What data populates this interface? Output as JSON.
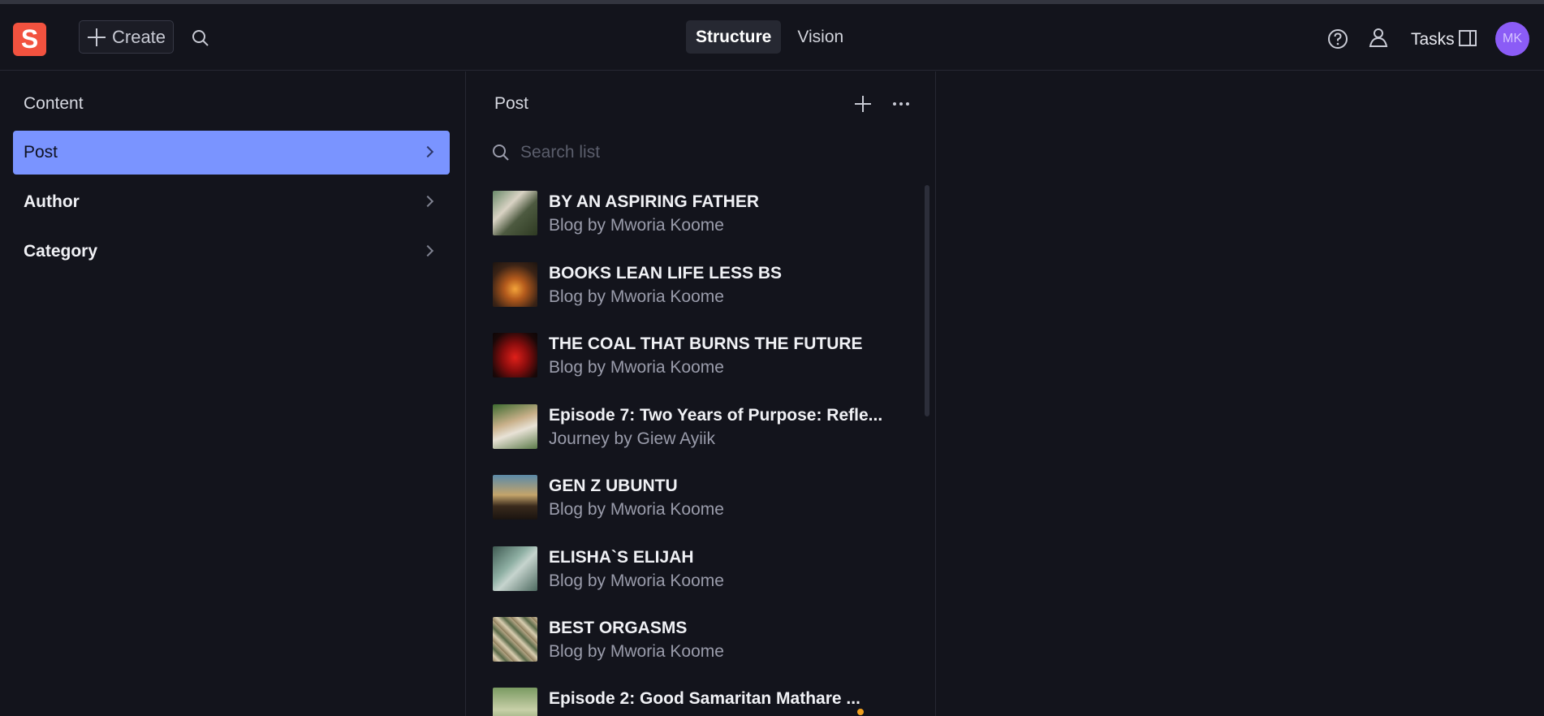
{
  "header": {
    "logo_letter": "S",
    "create_label": "Create",
    "tabs": [
      {
        "label": "Structure",
        "active": true
      },
      {
        "label": "Vision",
        "active": false
      }
    ],
    "tasks_label": "Tasks",
    "avatar_initials": "MK",
    "icons": [
      "search-icon",
      "help-icon",
      "people-icon",
      "panel-icon"
    ]
  },
  "content_pane": {
    "title": "Content",
    "items": [
      {
        "label": "Post",
        "selected": true
      },
      {
        "label": "Author",
        "selected": false
      },
      {
        "label": "Category",
        "selected": false
      }
    ]
  },
  "post_pane": {
    "title": "Post",
    "search_placeholder": "Search list",
    "items": [
      {
        "title": "BY AN ASPIRING FATHER",
        "subtitle": "Blog by Mworia Koome"
      },
      {
        "title": "BOOKS LEAN LIFE LESS BS",
        "subtitle": "Blog by Mworia Koome"
      },
      {
        "title": "THE COAL THAT BURNS THE FUTURE",
        "subtitle": "Blog by Mworia Koome"
      },
      {
        "title": "Episode 7: Two Years of Purpose: Refle...",
        "subtitle": "Journey by Giew Ayiik"
      },
      {
        "title": "GEN Z UBUNTU",
        "subtitle": "Blog by Mworia Koome"
      },
      {
        "title": "ELISHA`S ELIJAH",
        "subtitle": "Blog by Mworia Koome"
      },
      {
        "title": "BEST ORGASMS",
        "subtitle": "Blog by Mworia Koome"
      },
      {
        "title": "Episode 2: Good Samaritan Mathare ...",
        "subtitle": ""
      }
    ]
  },
  "colors": {
    "background": "#13141c",
    "accent_selected": "#7a94ff",
    "brand": "#f2523f",
    "avatar": "#8b5cf6",
    "status_dot": "#f0a020"
  }
}
